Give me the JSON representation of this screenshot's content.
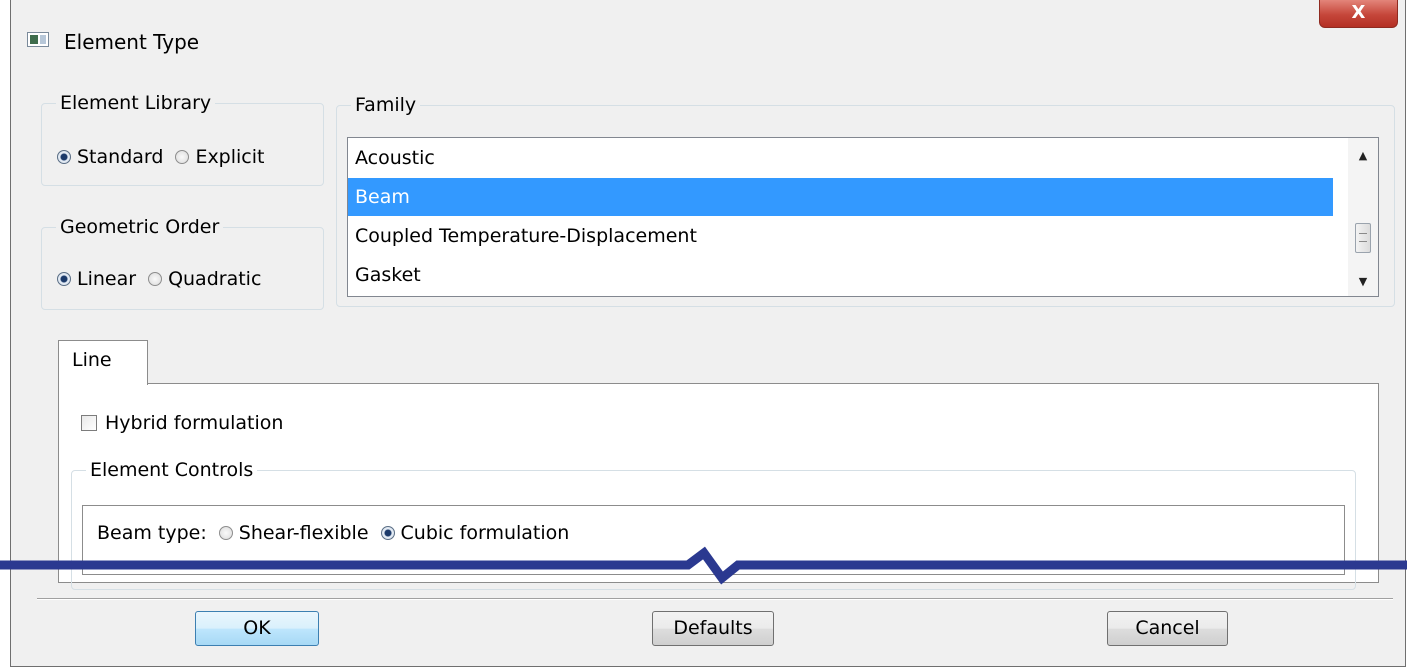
{
  "window": {
    "title": "Element Type",
    "close_glyph": "X",
    "title_icon": "window-app-icon"
  },
  "element_library": {
    "legend": "Element Library",
    "options": [
      {
        "label": "Standard",
        "checked": true
      },
      {
        "label": "Explicit",
        "checked": false
      }
    ]
  },
  "geometric_order": {
    "legend": "Geometric Order",
    "options": [
      {
        "label": "Linear",
        "checked": true
      },
      {
        "label": "Quadratic",
        "checked": false
      }
    ]
  },
  "family": {
    "legend": "Family",
    "items": [
      "Acoustic",
      "Beam",
      "Coupled Temperature-Displacement",
      "Gasket"
    ],
    "selected": "Beam",
    "scroll_up_glyph": "▲",
    "scroll_down_glyph": "▼"
  },
  "tabs": [
    {
      "label": "Line",
      "active": true
    }
  ],
  "line_tab": {
    "hybrid_label": "Hybrid formulation",
    "hybrid_checked": false,
    "element_controls_legend": "Element Controls",
    "beam_type_label": "Beam type:",
    "beam_type_options": [
      {
        "label": "Shear-flexible",
        "checked": false
      },
      {
        "label": "Cubic formulation",
        "checked": true
      }
    ]
  },
  "buttons": {
    "ok": "OK",
    "defaults": "Defaults",
    "cancel": "Cancel"
  },
  "colors": {
    "selection": "#3399ff",
    "break_line": "#2b3990",
    "close_button": "#c5463a"
  }
}
